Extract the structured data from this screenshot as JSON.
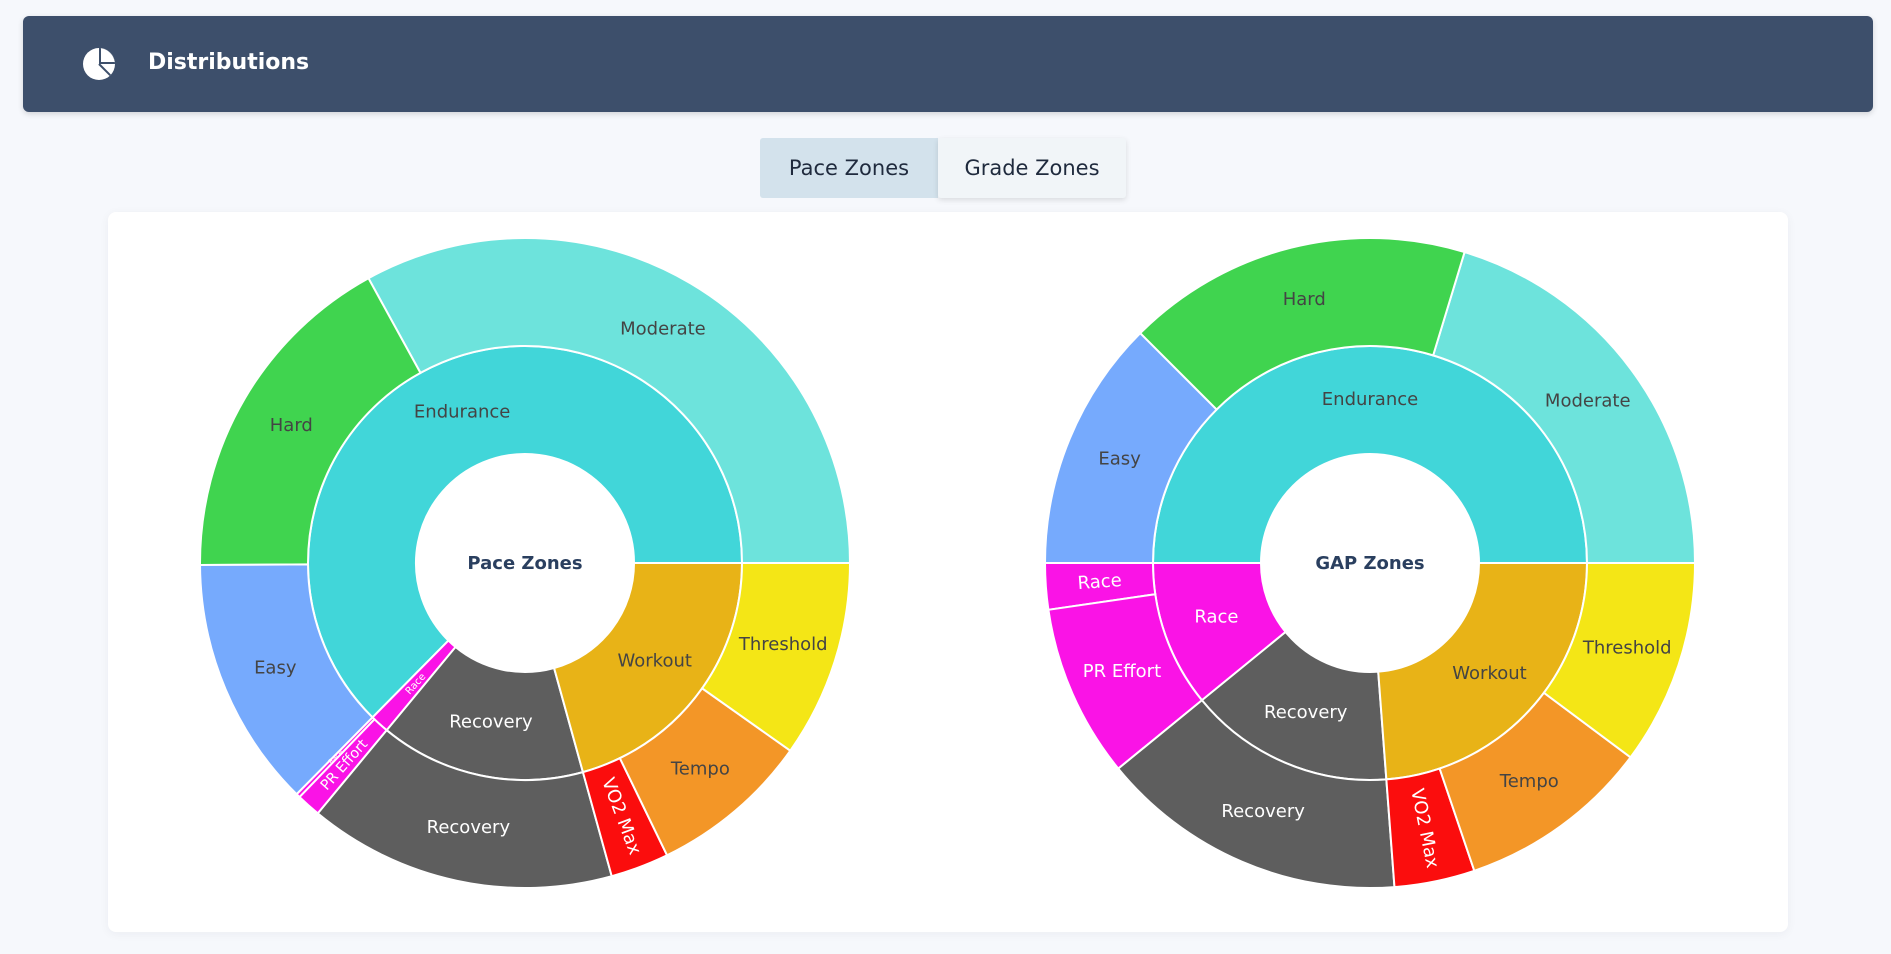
{
  "header": {
    "title": "Distributions",
    "icon": "pie-chart-icon"
  },
  "tabs": [
    {
      "label": "Pace Zones",
      "active": true
    },
    {
      "label": "Grade Zones",
      "active": false
    }
  ],
  "colors": {
    "Endurance": "#41d6d9",
    "Moderate": "#6de3dc",
    "Hard": "#40d44f",
    "Easy": "#76aafd",
    "Workout": "#e8b317",
    "Threshold": "#f4e616",
    "Tempo": "#f39627",
    "VO2 Max": "#fb0d0d",
    "Recovery": "#5e5e5e",
    "Race": "#fa13e6",
    "PR Effort": "#fa13e6"
  },
  "chart_data": [
    {
      "type": "sunburst",
      "title": "Pace Zones",
      "inner": [
        {
          "name": "Endurance",
          "value": 62.6
        },
        {
          "name": "Race",
          "value": 1.4
        },
        {
          "name": "Recovery",
          "value": 15.3
        },
        {
          "name": "Workout",
          "value": 20.7
        }
      ],
      "outer": [
        {
          "name": "Moderate",
          "parent": "Endurance",
          "value": 33.0
        },
        {
          "name": "Hard",
          "parent": "Endurance",
          "value": 17.1
        },
        {
          "name": "Easy",
          "parent": "Endurance",
          "value": 12.5
        },
        {
          "name": "Race",
          "parent": "Race",
          "value": 0.2
        },
        {
          "name": "PR Effort",
          "parent": "Race",
          "value": 1.2
        },
        {
          "name": "Recovery",
          "parent": "Recovery",
          "value": 15.3
        },
        {
          "name": "VO2 Max",
          "parent": "Workout",
          "value": 2.9
        },
        {
          "name": "Tempo",
          "parent": "Workout",
          "value": 8.0
        },
        {
          "name": "Threshold",
          "parent": "Workout",
          "value": 9.8
        }
      ]
    },
    {
      "type": "sunburst",
      "title": "GAP Zones",
      "inner": [
        {
          "name": "Endurance",
          "value": 50.0
        },
        {
          "name": "Race",
          "value": 10.9
        },
        {
          "name": "Recovery",
          "value": 15.3
        },
        {
          "name": "Workout",
          "value": 23.8
        }
      ],
      "outer": [
        {
          "name": "Moderate",
          "parent": "Endurance",
          "value": 20.3
        },
        {
          "name": "Hard",
          "parent": "Endurance",
          "value": 17.2
        },
        {
          "name": "Easy",
          "parent": "Endurance",
          "value": 12.5
        },
        {
          "name": "Race",
          "parent": "Race",
          "value": 2.3
        },
        {
          "name": "PR Effort",
          "parent": "Race",
          "value": 8.6
        },
        {
          "name": "Recovery",
          "parent": "Recovery",
          "value": 15.3
        },
        {
          "name": "VO2 Max",
          "parent": "Workout",
          "value": 4.0
        },
        {
          "name": "Tempo",
          "parent": "Workout",
          "value": 9.6
        },
        {
          "name": "Threshold",
          "parent": "Workout",
          "value": 10.2
        }
      ]
    }
  ]
}
